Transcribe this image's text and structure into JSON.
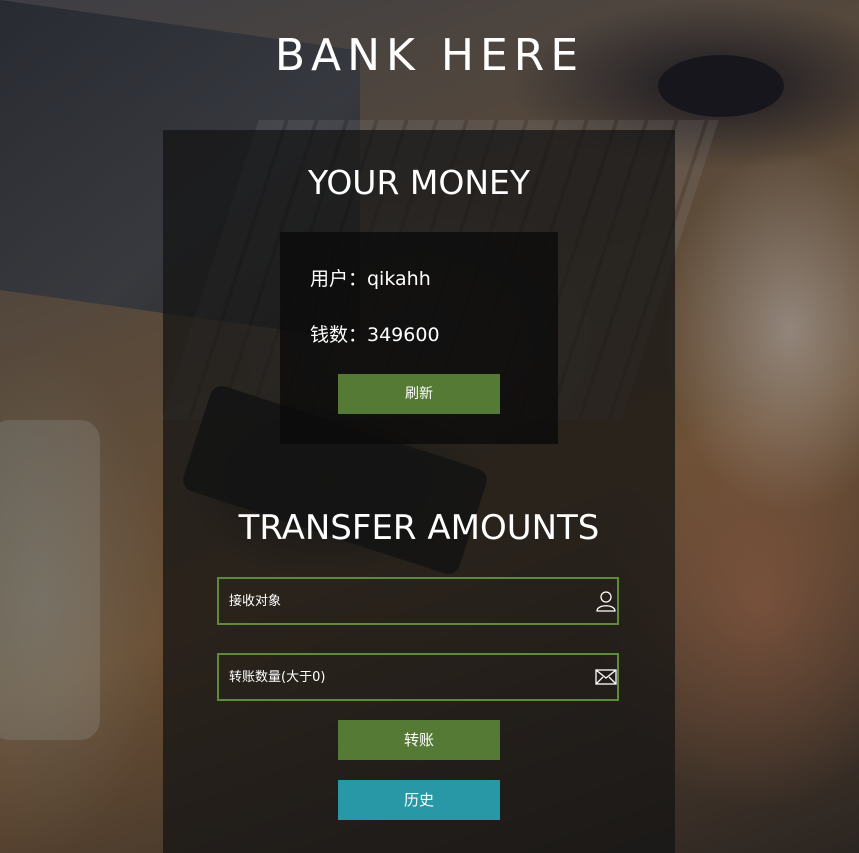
{
  "app": {
    "title": "BANK HERE"
  },
  "account": {
    "section_title": "YOUR MONEY",
    "user_line": "用户：qikahh",
    "money_line": "钱数：349600",
    "refresh_label": "刷新"
  },
  "transfer": {
    "section_title": "TRANSFER AMOUNTS",
    "recipient_placeholder": "接收对象",
    "recipient_icon": "user-icon",
    "amount_placeholder": "转账数量(大于0)",
    "amount_icon": "envelope-icon",
    "transfer_label": "转账",
    "history_label": "历史"
  },
  "colors": {
    "primary_button": "#557a35",
    "history_button": "#2898a6",
    "field_border": "#5e8a3a"
  }
}
